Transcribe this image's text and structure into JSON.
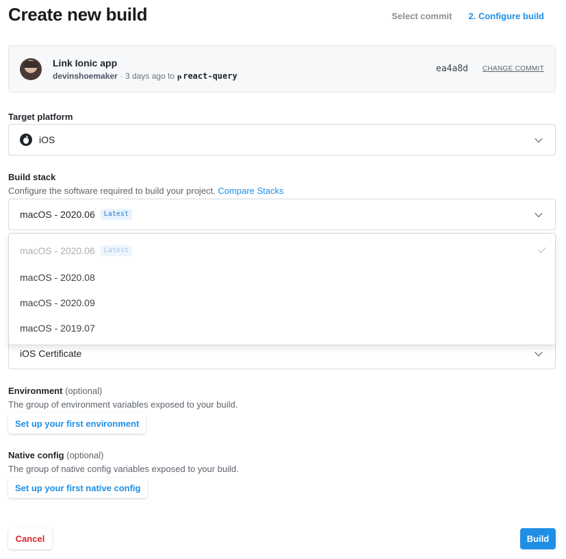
{
  "page_title": "Create new build",
  "steps": {
    "step1": "Select commit",
    "step2": "2. Configure build"
  },
  "commit": {
    "title": "Link Ionic app",
    "author": "devinshoemaker",
    "age_text": "· 3 days ago to",
    "branch_icon": "branch-icon",
    "branch": "react-query",
    "hash": "ea4a8d",
    "change_label": "CHANGE COMMIT"
  },
  "target_platform": {
    "label": "Target platform",
    "value": "iOS",
    "icon": "apple-icon"
  },
  "build_stack": {
    "label": "Build stack",
    "helper": "Configure the software required to build your project.",
    "helper_link": "Compare Stacks",
    "value": "macOS - 2020.06",
    "badge": "Latest",
    "options": [
      {
        "label": "macOS - 2020.06",
        "badge": "Latest",
        "selected": true
      },
      {
        "label": "macOS - 2020.08"
      },
      {
        "label": "macOS - 2020.09"
      },
      {
        "label": "macOS - 2019.07"
      }
    ]
  },
  "signing": {
    "value": "iOS Certificate"
  },
  "environment": {
    "label": "Environment",
    "optional": "(optional)",
    "helper": "The group of environment variables exposed to your build.",
    "button": "Set up your first environment"
  },
  "native_config": {
    "label": "Native config",
    "optional": "(optional)",
    "helper": "The group of native config variables exposed to your build.",
    "button": "Set up your first native config"
  },
  "footer": {
    "cancel": "Cancel",
    "build": "Build"
  },
  "colors": {
    "accent": "#1f8fe5",
    "danger": "#d9262c"
  }
}
